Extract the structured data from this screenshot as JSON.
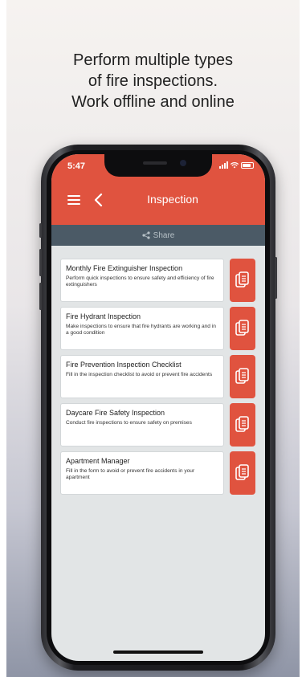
{
  "headline": {
    "line1": "Perform multiple types",
    "line2": "of fire inspections.",
    "line3": "Work offline and online"
  },
  "status_bar": {
    "time": "5:47"
  },
  "app_bar": {
    "title": "Inspection",
    "menu_icon": "hamburger-menu-icon",
    "back_icon": "chevron-left-icon"
  },
  "share_bar": {
    "label": "Share",
    "icon": "share-icon"
  },
  "inspections": [
    {
      "title": "Monthly Fire Extinguisher Inspection",
      "description": "Perform quick inspections to ensure safety and efficiency of fire extinguishers"
    },
    {
      "title": "Fire Hydrant Inspection",
      "description": "Make inspections to ensure that fire hydrants are working and in a good condition"
    },
    {
      "title": "Fire Prevention Inspection Checklist",
      "description": "Fill in the inspection checklist to avoid or prevent fire accidents"
    },
    {
      "title": "Daycare Fire Safety Inspection",
      "description": "Conduct fire inspections to ensure safety on premises"
    },
    {
      "title": "Apartment Manager",
      "description": "Fill in the form to avoid or prevent fire accidents in your apartment"
    }
  ],
  "colors": {
    "accent": "#e0533f",
    "share_bar": "#4b5a66",
    "screen_background": "#e2e5e6"
  }
}
